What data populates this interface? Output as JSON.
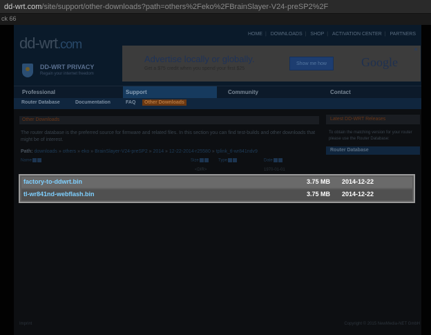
{
  "browser": {
    "url_domain": "dd-wrt.com",
    "url_path": "/site/support/other-downloads?path=others%2Feko%2FBrainSlayer-V24-preSP2%2F",
    "bookmark": "ck 66"
  },
  "header": {
    "logo": "dd-wrt",
    "logo_tld": ".com",
    "top_nav": [
      "HOME",
      "DOWNLOADS",
      "SHOP",
      "ACTIVATION CENTER",
      "PARTNERS"
    ],
    "privacy_title": "DD-WRT PRIVACY",
    "privacy_sub": "Regain your internet freedom"
  },
  "ad": {
    "title": "Advertise locally or globally.",
    "subtitle": "Get a $75 credit when you spend your first $25",
    "button": "Show me how",
    "brand": "Google",
    "close": "✕"
  },
  "main_nav": {
    "professional": "Professional",
    "support": "Support",
    "community": "Community",
    "contact": "Contact"
  },
  "sub_nav": {
    "router_database": "Router Database",
    "documentation": "Documentation",
    "faq": "FAQ",
    "other_downloads": "Other Downloads"
  },
  "content": {
    "title": "Other Downloads",
    "description": "The router database is the preferred source for firmware and related files. In this section you can find test-builds and other downloads that might be of interest.",
    "path_label": "Path:",
    "path_parts": [
      "downloads",
      "others",
      "eko",
      "BrainSlayer-V24-preSP2",
      "2014",
      "12-22-2014-r25580",
      "tplink_tl-wr841ndv9"
    ],
    "columns": {
      "name": "Name",
      "size": "Size",
      "type": "Type",
      "date": "Date"
    },
    "dir_row": {
      "type": "<DIR>",
      "date": "1970-01-01"
    }
  },
  "files": [
    {
      "name": "factory-to-ddwrt.bin",
      "size": "3.75 MB",
      "date": "2014-12-22"
    },
    {
      "name": "tl-wr841nd-webflash.bin",
      "size": "3.75 MB",
      "date": "2014-12-22"
    }
  ],
  "sidebar": {
    "title": "Latest DD-WRT Releases",
    "text": "To obtain the matching version for your router please use the Router Database:",
    "button": "Router Database"
  },
  "footer": {
    "left": "Imprint",
    "right": "Copyright © 2015 NewMedia-NET GmbH"
  }
}
